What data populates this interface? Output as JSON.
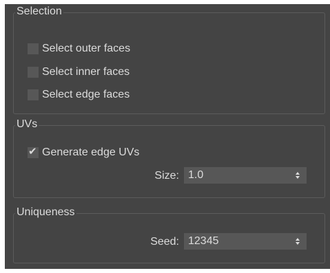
{
  "selection": {
    "title": "Selection",
    "items": [
      {
        "label": "Select outer faces",
        "checked": false
      },
      {
        "label": "Select inner faces",
        "checked": false
      },
      {
        "label": "Select edge faces",
        "checked": false
      }
    ]
  },
  "uvs": {
    "title": "UVs",
    "generate_edge_uvs": {
      "label": "Generate edge UVs",
      "checked": true,
      "check_glyph": "✔"
    },
    "size": {
      "label": "Size:",
      "value": "1.0"
    }
  },
  "uniqueness": {
    "title": "Uniqueness",
    "seed": {
      "label": "Seed:",
      "value": "12345"
    }
  },
  "colors": {
    "panel_bg": "#444444",
    "control_bg": "#575757",
    "border": "#5c5c5c",
    "text": "#dcdcdc"
  }
}
